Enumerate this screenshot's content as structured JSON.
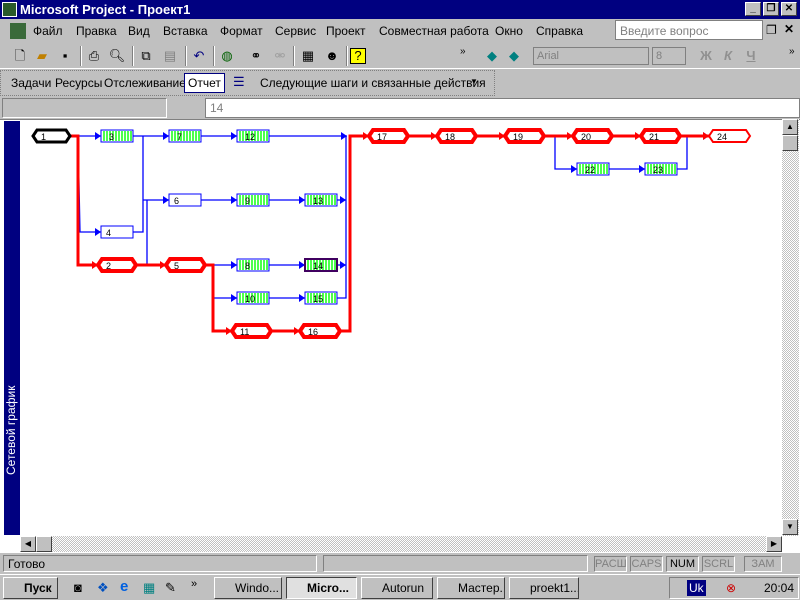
{
  "window": {
    "title": "Microsoft Project - Проект1"
  },
  "menu": [
    "Файл",
    "Правка",
    "Вид",
    "Вставка",
    "Формат",
    "Сервис",
    "Проект",
    "Совместная работа",
    "Окно",
    "Справка"
  ],
  "help_box": {
    "placeholder": "Введите вопрос"
  },
  "formatting": {
    "font": "Arial",
    "size": "8",
    "bold": "Ж",
    "italic": "К",
    "underline": "Ч"
  },
  "guide_toolbar": {
    "items": [
      "Задачи",
      "Ресурсы",
      "Отслеживание",
      "Отчет"
    ],
    "next_steps": "Следующие шаги и связанные действия"
  },
  "entry_bar": {
    "value": "14"
  },
  "view_label": "Сетевой график",
  "network": {
    "nodes": [
      {
        "id": "1",
        "type": "milestone-black"
      },
      {
        "id": "2",
        "type": "critical"
      },
      {
        "id": "3",
        "type": "progress"
      },
      {
        "id": "4",
        "type": "task"
      },
      {
        "id": "5",
        "type": "critical"
      },
      {
        "id": "6",
        "type": "task"
      },
      {
        "id": "7",
        "type": "progress"
      },
      {
        "id": "8",
        "type": "progress"
      },
      {
        "id": "9",
        "type": "progress"
      },
      {
        "id": "10",
        "type": "progress"
      },
      {
        "id": "11",
        "type": "critical"
      },
      {
        "id": "12",
        "type": "progress"
      },
      {
        "id": "13",
        "type": "progress"
      },
      {
        "id": "14",
        "type": "selected"
      },
      {
        "id": "15",
        "type": "progress"
      },
      {
        "id": "16",
        "type": "critical"
      },
      {
        "id": "17",
        "type": "critical"
      },
      {
        "id": "18",
        "type": "critical"
      },
      {
        "id": "19",
        "type": "critical"
      },
      {
        "id": "20",
        "type": "critical"
      },
      {
        "id": "21",
        "type": "critical"
      },
      {
        "id": "22",
        "type": "progress"
      },
      {
        "id": "23",
        "type": "progress"
      },
      {
        "id": "24",
        "type": "critical-thin"
      }
    ]
  },
  "status": {
    "text": "Готово",
    "indicators": [
      "РАСШ",
      "CAPS",
      "NUM",
      "SCRL",
      "ЗАМ"
    ]
  },
  "taskbar": {
    "start": "Пуск",
    "tasks": [
      "Windo...",
      "Micro...",
      "Autorun",
      "Мастер...",
      "proekt1..."
    ],
    "tray_lang": "Uk",
    "clock": "20:04"
  },
  "colors": {
    "critical": "#ff0000",
    "link": "#0000ff",
    "progress": "#00ff00",
    "titlebar": "#000080"
  }
}
